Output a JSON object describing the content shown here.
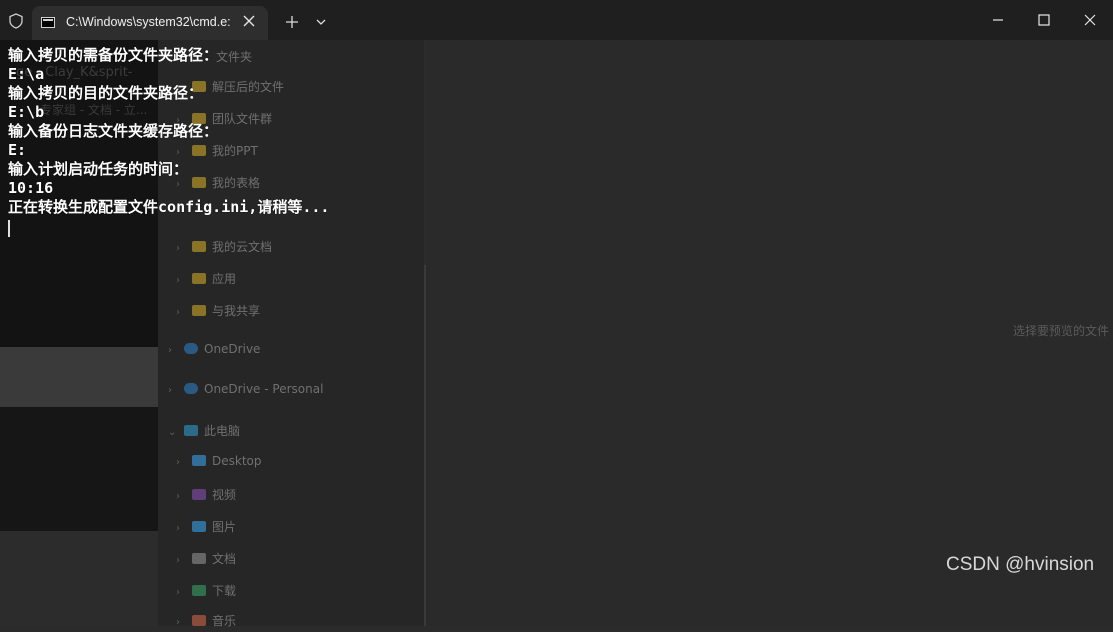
{
  "window": {
    "tab_title": "C:\\Windows\\system32\\cmd.e:",
    "icons": [
      "shield-icon",
      "terminal-icon",
      "close-icon",
      "plus-icon",
      "chevron-down-icon",
      "minimize-icon",
      "maximize-icon",
      "close-icon"
    ]
  },
  "console": {
    "lines": [
      "输入拷贝的需备份文件夹路径：",
      "E:\\a",
      "输入拷贝的目的文件夹路径：",
      "E:\\b",
      "输入备份日志文件夹缓存路径：",
      "E:",
      "输入计划启动任务的时间：",
      "10:16",
      "正在转换生成配置文件config.ini,请稍等..."
    ]
  },
  "background_window": {
    "left_text_1": "ge - Clay_K&sprit-",
    "left_text_2": "专家组 - 文档 - 立...",
    "top_folder": "文件夹",
    "tree": [
      {
        "label": "解压后的文件",
        "icon": "folder-icon"
      },
      {
        "label": "团队文件群",
        "icon": "folder-icon"
      },
      {
        "label": "我的PPT",
        "icon": "folder-icon"
      },
      {
        "label": "我的表格",
        "icon": "folder-icon"
      },
      {
        "label": "我的云文档",
        "icon": "folder-icon"
      },
      {
        "label": "应用",
        "icon": "folder-icon"
      },
      {
        "label": "与我共享",
        "icon": "folder-icon"
      },
      {
        "label": "OneDrive",
        "icon": "cloud-icon"
      },
      {
        "label": "OneDrive - Personal",
        "icon": "cloud-icon"
      },
      {
        "label": "此电脑",
        "icon": "computer-icon"
      },
      {
        "label": "Desktop",
        "icon": "desktop-icon"
      },
      {
        "label": "视频",
        "icon": "video-icon"
      },
      {
        "label": "图片",
        "icon": "picture-icon"
      },
      {
        "label": "文档",
        "icon": "document-icon"
      },
      {
        "label": "下载",
        "icon": "download-icon"
      },
      {
        "label": "音乐",
        "icon": "music-icon"
      }
    ],
    "preview_text": "选择要预览的文件"
  },
  "watermark": "CSDN @hvinsion"
}
